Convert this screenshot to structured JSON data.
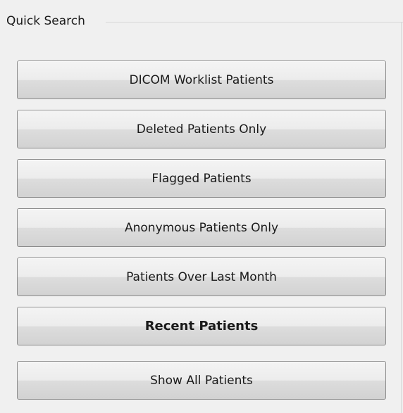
{
  "quick_search": {
    "title": "Quick Search",
    "buttons": [
      {
        "label": "DICOM Worklist Patients"
      },
      {
        "label": "Deleted Patients Only"
      },
      {
        "label": "Flagged Patients"
      },
      {
        "label": "Anonymous Patients Only"
      },
      {
        "label": "Patients Over Last Month"
      },
      {
        "label": "Recent Patients"
      },
      {
        "label": "Show All Patients"
      }
    ]
  }
}
